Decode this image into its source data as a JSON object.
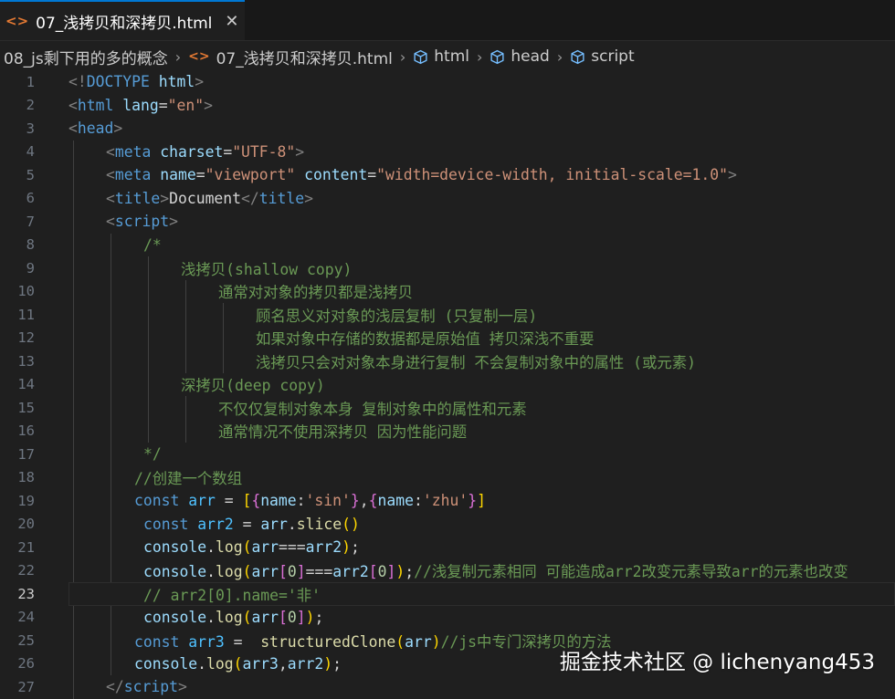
{
  "tab": {
    "file_icon": "<>",
    "title": "07_浅拷贝和深拷贝.html",
    "close": "✕"
  },
  "breadcrumb": {
    "folder": "08_js剩下用的多的概念",
    "file_icon": "<>",
    "file": "07_浅拷贝和深拷贝.html",
    "html": "html",
    "head": "head",
    "script": "script"
  },
  "editor": {
    "current_line": 23,
    "lines": [
      {
        "n": "1",
        "tokens": [
          [
            "br",
            "<!"
          ],
          [
            "tag",
            "DOCTYPE"
          ],
          [
            "txt",
            " "
          ],
          [
            "attr",
            "html"
          ],
          [
            "br",
            ">"
          ]
        ]
      },
      {
        "n": "2",
        "tokens": [
          [
            "br",
            "<"
          ],
          [
            "tag",
            "html"
          ],
          [
            "txt",
            " "
          ],
          [
            "attr",
            "lang"
          ],
          [
            "txt",
            "="
          ],
          [
            "str",
            "\"en\""
          ],
          [
            "br",
            ">"
          ]
        ]
      },
      {
        "n": "3",
        "tokens": [
          [
            "br",
            "<"
          ],
          [
            "tag",
            "head"
          ],
          [
            "br",
            ">"
          ]
        ]
      },
      {
        "n": "4",
        "tokens": [
          [
            "br",
            "<"
          ],
          [
            "tag",
            "meta"
          ],
          [
            "txt",
            " "
          ],
          [
            "attr",
            "charset"
          ],
          [
            "txt",
            "="
          ],
          [
            "str",
            "\"UTF-8\""
          ],
          [
            "br",
            ">"
          ]
        ]
      },
      {
        "n": "5",
        "tokens": [
          [
            "br",
            "<"
          ],
          [
            "tag",
            "meta"
          ],
          [
            "txt",
            " "
          ],
          [
            "attr",
            "name"
          ],
          [
            "txt",
            "="
          ],
          [
            "str",
            "\"viewport\""
          ],
          [
            "txt",
            " "
          ],
          [
            "attr",
            "content"
          ],
          [
            "txt",
            "="
          ],
          [
            "str",
            "\"width=device-width, initial-scale=1.0\""
          ],
          [
            "br",
            ">"
          ]
        ]
      },
      {
        "n": "6",
        "tokens": [
          [
            "br",
            "<"
          ],
          [
            "tag",
            "title"
          ],
          [
            "br",
            ">"
          ],
          [
            "txt",
            "Document"
          ],
          [
            "br",
            "</"
          ],
          [
            "tag",
            "title"
          ],
          [
            "br",
            ">"
          ]
        ]
      },
      {
        "n": "7",
        "tokens": [
          [
            "br",
            "<"
          ],
          [
            "tag",
            "script"
          ],
          [
            "br",
            ">"
          ]
        ]
      },
      {
        "n": "8",
        "tokens": [
          [
            "com",
            "/*"
          ]
        ]
      },
      {
        "n": "9",
        "tokens": [
          [
            "com",
            "浅拷贝(shallow copy)"
          ]
        ]
      },
      {
        "n": "10",
        "tokens": [
          [
            "com",
            "通常对对象的拷贝都是浅拷贝"
          ]
        ]
      },
      {
        "n": "11",
        "tokens": [
          [
            "com",
            "顾名思义对对象的浅层复制 (只复制一层)"
          ]
        ]
      },
      {
        "n": "12",
        "tokens": [
          [
            "com",
            "如果对象中存储的数据都是原始值 拷贝深浅不重要"
          ]
        ]
      },
      {
        "n": "13",
        "tokens": [
          [
            "com",
            "浅拷贝只会对对象本身进行复制 不会复制对象中的属性 (或元素)"
          ]
        ]
      },
      {
        "n": "14",
        "tokens": [
          [
            "com",
            "深拷贝(deep copy)"
          ]
        ]
      },
      {
        "n": "15",
        "tokens": [
          [
            "com",
            "不仅仅复制对象本身 复制对象中的属性和元素"
          ]
        ]
      },
      {
        "n": "16",
        "tokens": [
          [
            "com",
            "通常情况不使用深拷贝 因为性能问题"
          ]
        ]
      },
      {
        "n": "17",
        "tokens": [
          [
            "com",
            "*/"
          ]
        ]
      },
      {
        "n": "18",
        "tokens": [
          [
            "com",
            "//创建一个数组"
          ]
        ]
      },
      {
        "n": "19",
        "tokens": [
          [
            "kw",
            "const"
          ],
          [
            "txt",
            " "
          ],
          [
            "var",
            "arr"
          ],
          [
            "txt",
            " = "
          ],
          [
            "b1",
            "["
          ],
          [
            "b2",
            "{"
          ],
          [
            "id",
            "name"
          ],
          [
            "txt",
            ":"
          ],
          [
            "str",
            "'sin'"
          ],
          [
            "b2",
            "}"
          ],
          [
            "txt",
            ","
          ],
          [
            "b2",
            "{"
          ],
          [
            "id",
            "name"
          ],
          [
            "txt",
            ":"
          ],
          [
            "str",
            "'zhu'"
          ],
          [
            "b2",
            "}"
          ],
          [
            "b1",
            "]"
          ]
        ]
      },
      {
        "n": "20",
        "tokens": [
          [
            "kw",
            "const"
          ],
          [
            "txt",
            " "
          ],
          [
            "var",
            "arr2"
          ],
          [
            "txt",
            " = "
          ],
          [
            "id",
            "arr"
          ],
          [
            "txt",
            "."
          ],
          [
            "fn",
            "slice"
          ],
          [
            "b1",
            "()"
          ]
        ]
      },
      {
        "n": "21",
        "tokens": [
          [
            "id",
            "console"
          ],
          [
            "txt",
            "."
          ],
          [
            "fn",
            "log"
          ],
          [
            "b1",
            "("
          ],
          [
            "id",
            "arr"
          ],
          [
            "txt",
            "==="
          ],
          [
            "id",
            "arr2"
          ],
          [
            "b1",
            ")"
          ],
          [
            "txt",
            ";"
          ]
        ]
      },
      {
        "n": "22",
        "tokens": [
          [
            "id",
            "console"
          ],
          [
            "txt",
            "."
          ],
          [
            "fn",
            "log"
          ],
          [
            "b1",
            "("
          ],
          [
            "id",
            "arr"
          ],
          [
            "b2",
            "["
          ],
          [
            "num",
            "0"
          ],
          [
            "b2",
            "]"
          ],
          [
            "txt",
            "==="
          ],
          [
            "id",
            "arr2"
          ],
          [
            "b2",
            "["
          ],
          [
            "num",
            "0"
          ],
          [
            "b2",
            "]"
          ],
          [
            "b1",
            ")"
          ],
          [
            "txt",
            ";"
          ],
          [
            "com",
            "//浅复制元素相同 可能造成arr2改变元素导致arr的元素也改变"
          ]
        ]
      },
      {
        "n": "23",
        "tokens": [
          [
            "com",
            "// arr2[0].name='非'"
          ]
        ]
      },
      {
        "n": "24",
        "tokens": [
          [
            "id",
            "console"
          ],
          [
            "txt",
            "."
          ],
          [
            "fn",
            "log"
          ],
          [
            "b1",
            "("
          ],
          [
            "id",
            "arr"
          ],
          [
            "b2",
            "["
          ],
          [
            "num",
            "0"
          ],
          [
            "b2",
            "]"
          ],
          [
            "b1",
            ")"
          ],
          [
            "txt",
            ";"
          ]
        ]
      },
      {
        "n": "25",
        "tokens": [
          [
            "kw",
            "const"
          ],
          [
            "txt",
            " "
          ],
          [
            "var",
            "arr3"
          ],
          [
            "txt",
            " =  "
          ],
          [
            "fn",
            "structuredClone"
          ],
          [
            "b1",
            "("
          ],
          [
            "id",
            "arr"
          ],
          [
            "b1",
            ")"
          ],
          [
            "com",
            "//js中专门深拷贝的方法"
          ]
        ]
      },
      {
        "n": "26",
        "tokens": [
          [
            "id",
            "console"
          ],
          [
            "txt",
            "."
          ],
          [
            "fn",
            "log"
          ],
          [
            "b1",
            "("
          ],
          [
            "id",
            "arr3"
          ],
          [
            "txt",
            ","
          ],
          [
            "id",
            "arr2"
          ],
          [
            "b1",
            ")"
          ],
          [
            "txt",
            ";"
          ]
        ]
      },
      {
        "n": "27",
        "tokens": [
          [
            "br",
            "</"
          ],
          [
            "tag",
            "script"
          ],
          [
            "br",
            ">"
          ]
        ]
      }
    ]
  },
  "watermark": "掘金技术社区 @ lichenyang453",
  "colors": {
    "background": "#1f1f1f",
    "tag": "#569cd6",
    "attribute": "#9cdcfe",
    "string": "#ce9178",
    "comment": "#6a9955",
    "function": "#dcdcaa",
    "number": "#b5cea8"
  }
}
